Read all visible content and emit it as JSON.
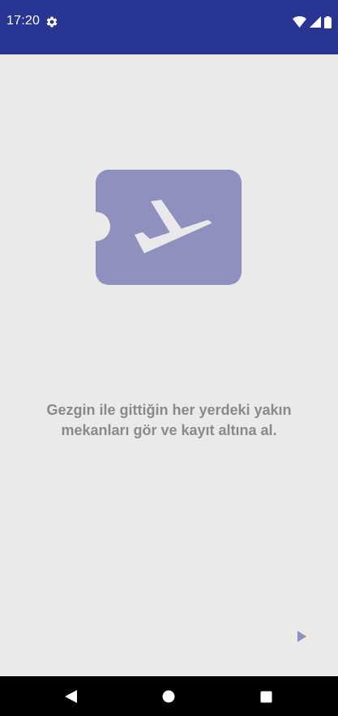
{
  "status_bar": {
    "time": "17:20",
    "icons": [
      "gear-icon",
      "wifi-icon",
      "signal-icon",
      "battery-icon"
    ],
    "background_color": "#283593"
  },
  "onboarding": {
    "illustration": "airplane-ticket-icon",
    "illustration_color": "#8f90bd",
    "message_line1": "Gezgin ile gittiğin her yerdeki yakın",
    "message_line2": "mekanları gör ve kayıt altına al.",
    "next_icon": "play-arrow-icon"
  },
  "navigation_bar": {
    "buttons": [
      "back-icon",
      "home-icon",
      "recents-icon"
    ]
  }
}
